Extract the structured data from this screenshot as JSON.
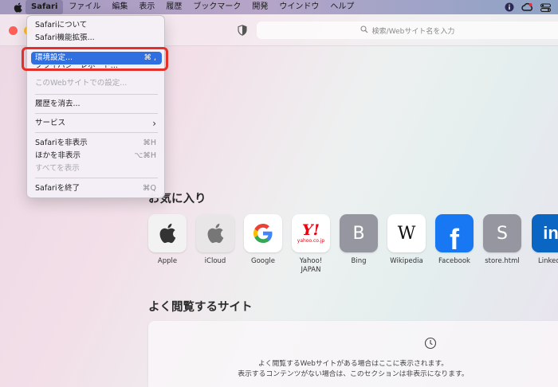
{
  "menubar": {
    "app_name": "Safari",
    "items": [
      "ファイル",
      "編集",
      "表示",
      "履歴",
      "ブックマーク",
      "開発",
      "ウインドウ",
      "ヘルプ"
    ]
  },
  "toolbar": {
    "search_placeholder": "検索/Webサイト名を入力"
  },
  "safari_menu": {
    "about": "Safariについて",
    "extensions": "Safari機能拡張...",
    "settings": "環境設定...",
    "settings_shortcut": "⌘ ,",
    "report": "プライバシーレポート...",
    "site_settings": "このWebサイトでの設定...",
    "clear_history": "履歴を消去...",
    "services": "サービス",
    "services_arrow": "›",
    "hide_safari": "Safariを非表示",
    "hide_safari_shortcut": "⌘H",
    "hide_others": "ほかを非表示",
    "hide_others_shortcut": "⌥⌘H",
    "show_all": "すべてを表示",
    "quit": "Safariを終了",
    "quit_shortcut": "⌘Q"
  },
  "favorites": {
    "title": "お気に入り",
    "items": [
      {
        "label": "Apple",
        "icon": "apple-logo-icon"
      },
      {
        "label": "iCloud",
        "icon": "apple-logo-icon"
      },
      {
        "label": "Google",
        "icon": "google-g-icon"
      },
      {
        "label": "Yahoo!\nJAPAN",
        "icon": "yahoo-japan-icon",
        "tile_text": "Y!",
        "tile_sub": "yahoo.co.jp"
      },
      {
        "label": "Bing",
        "icon": "letter-b-icon",
        "tile_text": "B"
      },
      {
        "label": "Wikipedia",
        "icon": "wikipedia-w-icon",
        "tile_text": "W"
      },
      {
        "label": "Facebook",
        "icon": "facebook-f-icon",
        "tile_text": "f"
      },
      {
        "label": "store.html",
        "icon": "letter-s-icon",
        "tile_text": "S"
      },
      {
        "label": "Linked",
        "icon": "linkedin-in-icon",
        "tile_text": "in"
      }
    ]
  },
  "frequently_visited": {
    "title": "よく閲覧するサイト",
    "line1": "よく閲覧するWebサイトがある場合はここに表示されます。",
    "line2": "表示するコンテンツがない場合は、このセクションは非表示になります。"
  },
  "colors": {
    "highlight": "#2f6fe0",
    "annotation_box": "#e5302a",
    "traffic_close": "#ff5f57",
    "traffic_min": "#febc2e"
  }
}
